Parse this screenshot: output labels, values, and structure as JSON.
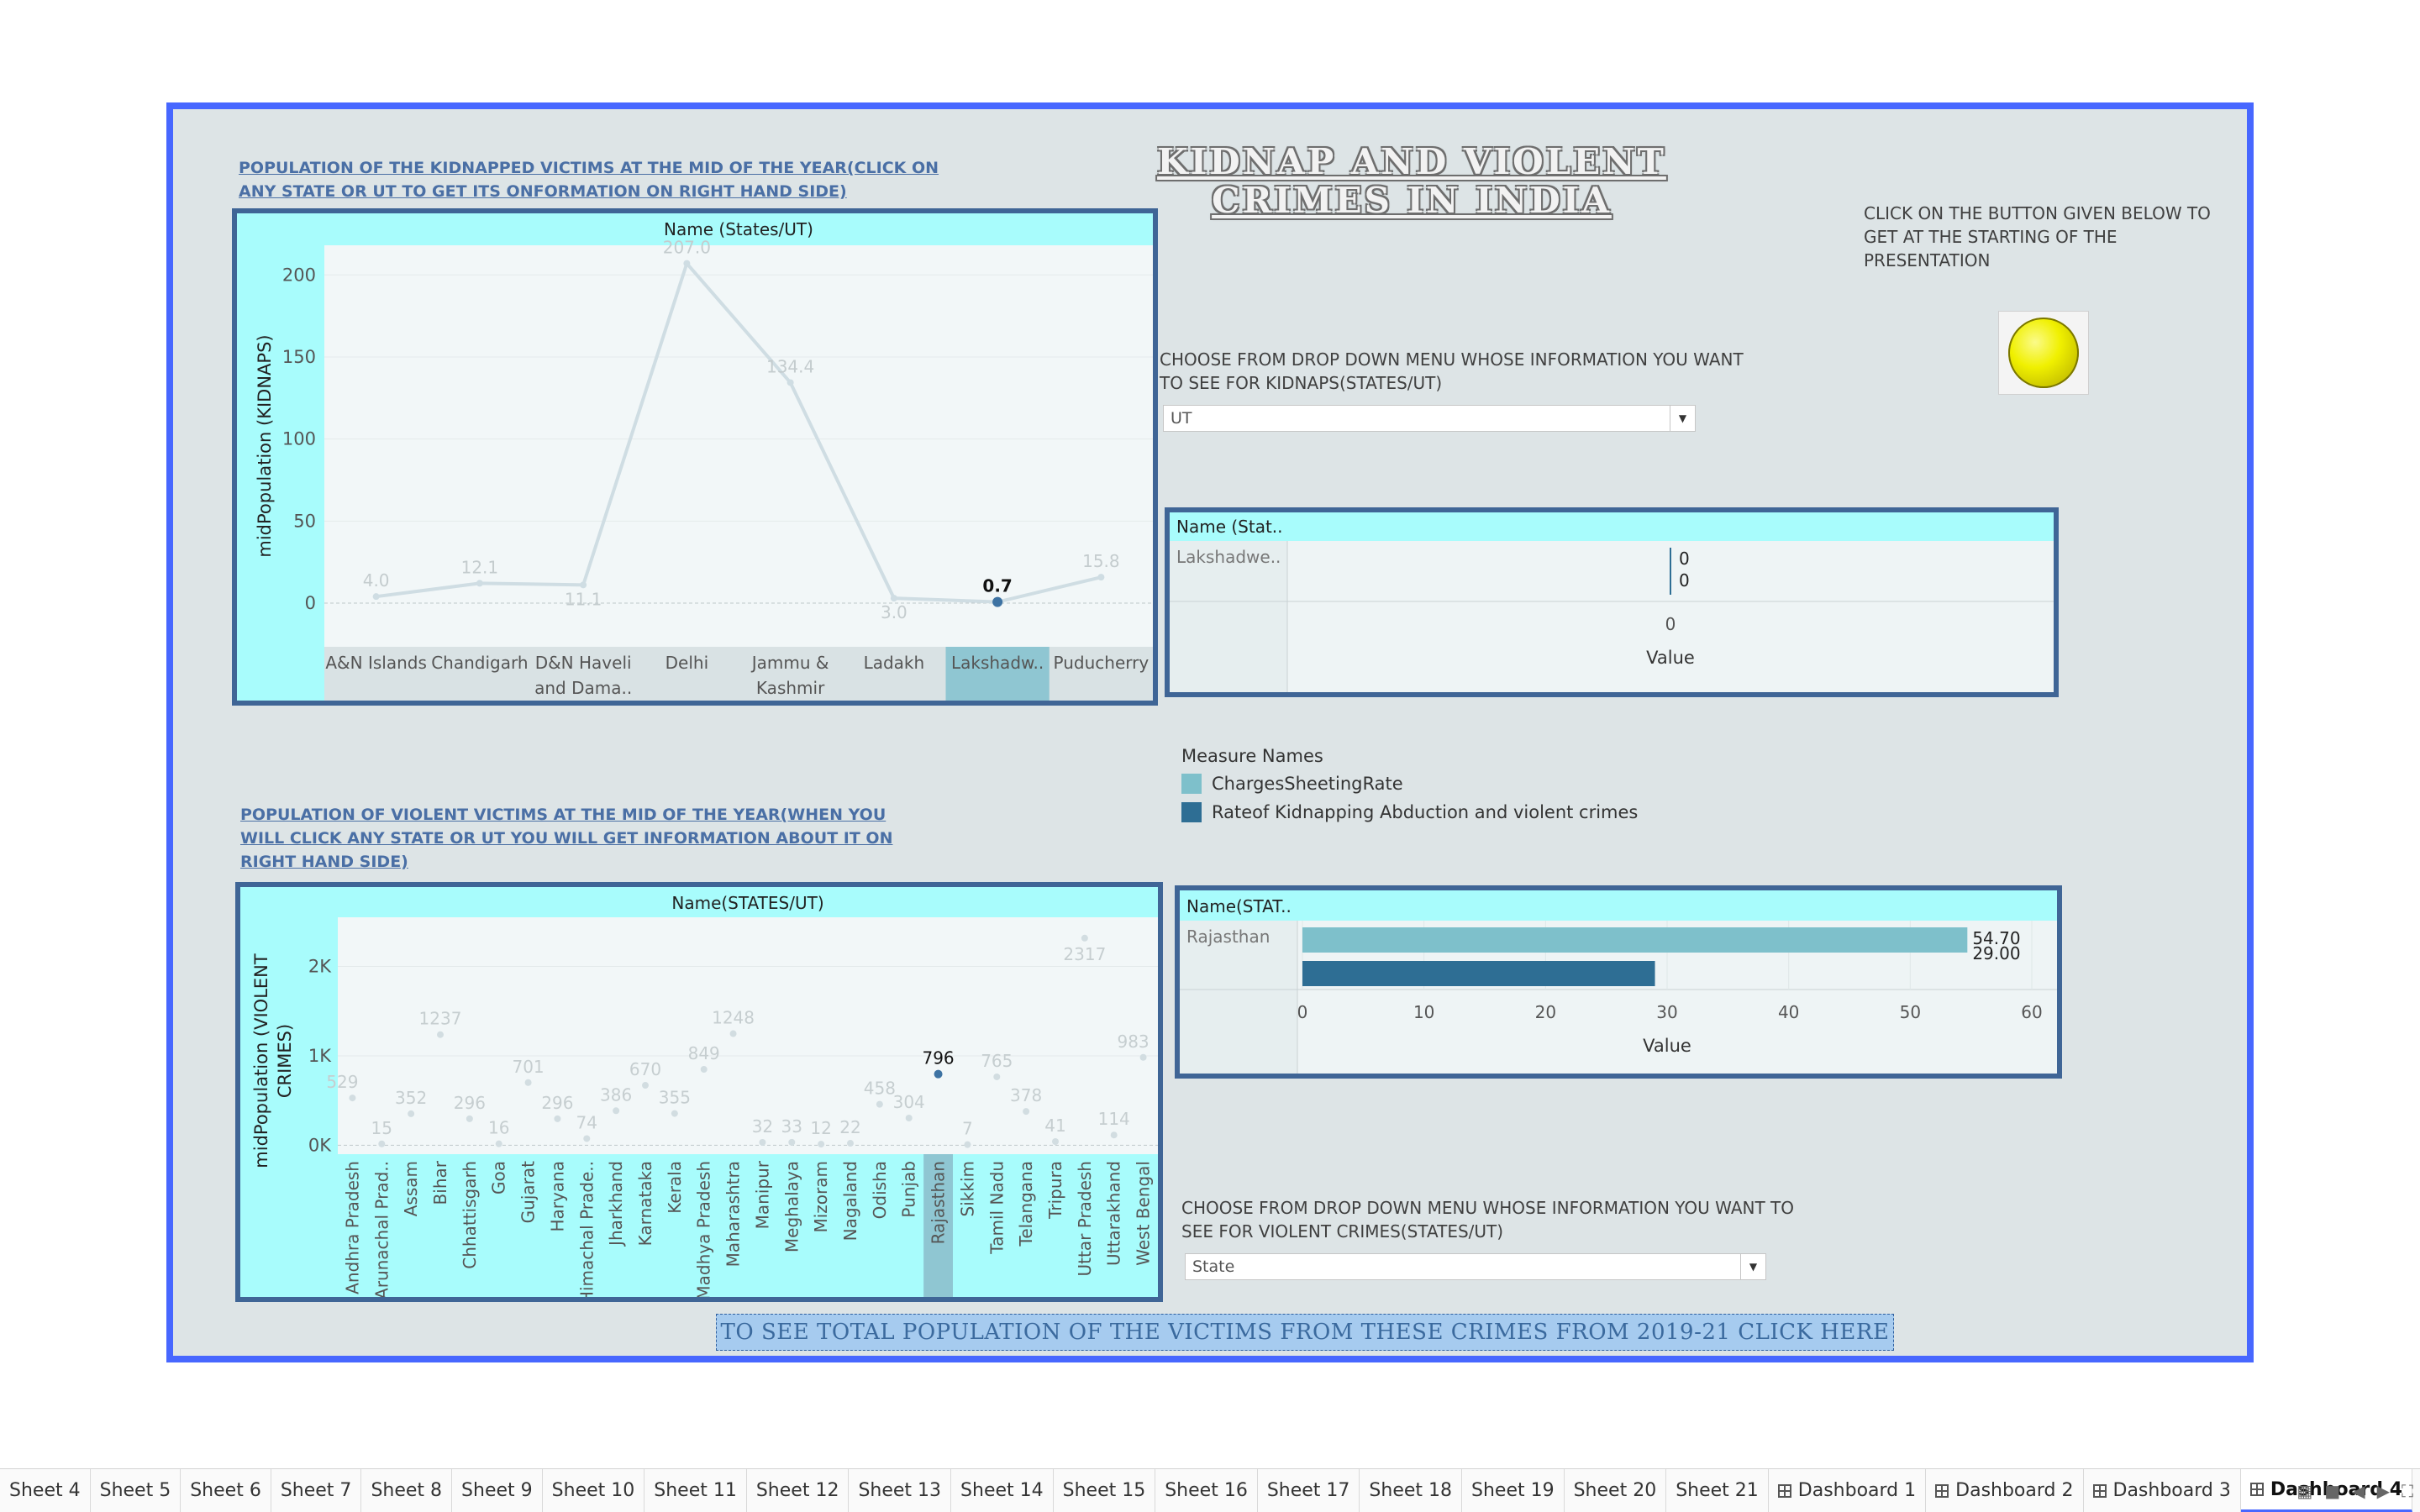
{
  "kidnap_chart_caption": "POPULATION OF THE KIDNAPPED VICTIMS AT THE MID  OF THE YEAR(CLICK ON ANY STATE OR UT TO GET ITS ONFORMATION ON RIGHT HAND SIDE)",
  "main_title_line1": "KIDNAP AND VIOLENT",
  "main_title_line2": "CRIMES IN INDIA",
  "start_button_note": "CLICK ON THE BUTTON GIVEN BELOW TO GET AT THE STARTING OF THE PRESENTATION",
  "kidnap_dropdown": {
    "label": "CHOOSE FROM DROP DOWN MENU WHOSE INFORMATION YOU WANT TO SEE FOR KIDNAPS(STATES/UT)",
    "value": "UT"
  },
  "violent_dropdown": {
    "label": "CHOOSE FROM DROP DOWN MENU WHOSE INFORMATION YOU WANT TO SEE FOR VIOLENT CRIMES(STATES/UT)",
    "value": "State"
  },
  "violent_chart_caption": "POPULATION OF VIOLENT VICTIMS AT THE MID OF THE YEAR(WHEN YOU WILL CLICK ANY STATE OR UT YOU WILL GET INFORMATION ABOUT IT ON RIGHT HAND SIDE)",
  "legend": {
    "title": "Measure Names",
    "items": [
      {
        "label": "ChargesSheetingRate",
        "color": "#7ec0cb"
      },
      {
        "label": "Rateof Kidnapping Abduction and violent crimes",
        "color": "#2e6e94"
      }
    ]
  },
  "presentation_button": "TO SEE TOTAL POPULATION OF THE VICTIMS FROM THESE CRIMES FROM 2019-21 CLICK HERE",
  "tabs": [
    "Sheet 4",
    "Sheet 5",
    "Sheet 6",
    "Sheet 7",
    "Sheet 8",
    "Sheet 9",
    "Sheet 10",
    "Sheet 11",
    "Sheet 12",
    "Sheet 13",
    "Sheet 14",
    "Sheet 15",
    "Sheet 16",
    "Sheet 17",
    "Sheet 18",
    "Sheet 19",
    "Sheet 20",
    "Sheet 21",
    "Dashboard 1",
    "Dashboard 2",
    "Dashboard 3",
    "Dashboard 4"
  ],
  "active_tab": "Dashboard 4",
  "chart_data": [
    {
      "type": "line",
      "title": "Name (States/UT)",
      "ylabel": "midPopulation (KIDNAPS)",
      "xlabel": "",
      "categories": [
        "A&N Islands",
        "Chandigarh",
        "D&N Haveli and Dama..",
        "Delhi",
        "Jammu & Kashmir",
        "Ladakh",
        "Lakshadw..",
        "Puducherry"
      ],
      "values": [
        4.0,
        12.1,
        11.1,
        207.0,
        134.4,
        3.0,
        0.7,
        15.8
      ],
      "labels": [
        "4.0",
        "12.1",
        "11.1",
        "207.0",
        "134.4",
        "3.0",
        "0.7",
        "15.8"
      ],
      "highlighted": "Lakshadw..",
      "ylim": [
        0,
        215
      ],
      "yticks": [
        0,
        50,
        100,
        150,
        200
      ],
      "grid": "horizontal"
    },
    {
      "type": "bar",
      "orientation": "horizontal",
      "title": "Name (Stat..",
      "categories": [
        "Lakshadwe.."
      ],
      "series": [
        {
          "name": "ChargesSheetingRate",
          "values": [
            0
          ]
        },
        {
          "name": "Rateof Kidnapping Abduction and violent crimes",
          "values": [
            0
          ]
        }
      ],
      "labels": [
        "0",
        "0"
      ],
      "xticks": [
        0
      ],
      "xlabel": "Value"
    },
    {
      "type": "scatter",
      "title": "Name(STATES/UT)",
      "ylabel": "midPopulation (VIOLENT CRIMES)",
      "categories": [
        "Andhra Pradesh",
        "Arunachal Prad..",
        "Assam",
        "Bihar",
        "Chhattisgarh",
        "Goa",
        "Gujarat",
        "Haryana",
        "Himachal Prade..",
        "Jharkhand",
        "Karnataka",
        "Kerala",
        "Madhya Pradesh",
        "Maharashtra",
        "Manipur",
        "Meghalaya",
        "Mizoram",
        "Nagaland",
        "Odisha",
        "Punjab",
        "Rajasthan",
        "Sikkim",
        "Tamil Nadu",
        "Telangana",
        "Tripura",
        "Uttar Pradesh",
        "Uttarakhand",
        "West Bengal"
      ],
      "values": [
        529,
        15,
        352,
        1237,
        296,
        16,
        701,
        296,
        74,
        386,
        670,
        355,
        849,
        1248,
        32,
        33,
        12,
        22,
        458,
        304,
        796,
        7,
        765,
        378,
        41,
        2317,
        114,
        983
      ],
      "labels": [
        "529",
        "15",
        "352",
        "1237",
        "296",
        "16",
        "701",
        "296",
        "74",
        "386",
        "670",
        "355",
        "849",
        "1248",
        "32",
        "33",
        "12",
        "22",
        "458",
        "304",
        "796",
        "7",
        "765",
        "378",
        "41",
        "2317",
        "114",
        "983"
      ],
      "highlighted": "Rajasthan",
      "ylim": [
        -100,
        2550
      ],
      "yticks": [
        0,
        1000,
        2000
      ],
      "ytick_labels": [
        "0K",
        "1K",
        "2K"
      ]
    },
    {
      "type": "bar",
      "orientation": "horizontal",
      "title": "Name(STAT..",
      "categories": [
        "Rajasthan"
      ],
      "series": [
        {
          "name": "ChargesSheetingRate",
          "values": [
            54.7
          ]
        },
        {
          "name": "Rateof Kidnapping Abduction and violent crimes",
          "values": [
            29.0
          ]
        }
      ],
      "labels": [
        "54.70",
        "29.00"
      ],
      "xlim": [
        0,
        60
      ],
      "xticks": [
        0,
        10,
        20,
        30,
        40,
        50,
        60
      ],
      "xlabel": "Value"
    }
  ]
}
